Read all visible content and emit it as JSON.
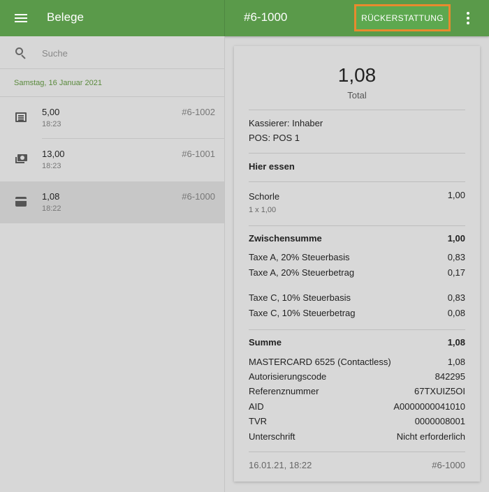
{
  "topbar": {
    "title": "Belege",
    "receipt_id": "#6-1000",
    "refund_label": "RÜCKERSTATTUNG"
  },
  "search": {
    "placeholder": "Suche",
    "value": ""
  },
  "list": {
    "date_header": "Samstag, 16 Januar 2021",
    "items": [
      {
        "amount": "5,00",
        "time": "18:23",
        "id": "#6-1002",
        "icon": "receipt-list-icon",
        "selected": false
      },
      {
        "amount": "13,00",
        "time": "18:23",
        "id": "#6-1001",
        "icon": "cash-icon",
        "selected": false
      },
      {
        "amount": "1,08",
        "time": "18:22",
        "id": "#6-1000",
        "icon": "credit-card-icon",
        "selected": true
      }
    ]
  },
  "receipt": {
    "total": "1,08",
    "total_label": "Total",
    "cashier": "Kassierer: Inhaber",
    "pos": "POS: POS 1",
    "dining": "Hier essen",
    "line_item": {
      "name": "Schorle",
      "price": "1,00",
      "detail": "1 x 1,00"
    },
    "subtotal": {
      "label": "Zwischensumme",
      "value": "1,00"
    },
    "taxes": [
      {
        "label": "Taxe A,  20%  Steuerbasis",
        "value": "0,83"
      },
      {
        "label": "Taxe A,  20%  Steuerbetrag",
        "value": "0,17"
      },
      {
        "label": "Taxe C,  10%  Steuerbasis",
        "value": "0,83"
      },
      {
        "label": "Taxe C,  10%  Steuerbetrag",
        "value": "0,08"
      }
    ],
    "sum": {
      "label": "Summe",
      "value": "1,08"
    },
    "payment": [
      {
        "label": "MASTERCARD 6525 (Contactless)",
        "value": "1,08"
      },
      {
        "label": "Autorisierungscode",
        "value": "842295"
      },
      {
        "label": "Referenznummer",
        "value": "67TXUIZ5OI"
      },
      {
        "label": "AID",
        "value": "A0000000041010"
      },
      {
        "label": "TVR",
        "value": "0000008001"
      },
      {
        "label": "Unterschrift",
        "value": "Nicht erforderlich"
      }
    ],
    "footer": {
      "datetime": "16.01.21, 18:22",
      "id": "#6-1000"
    }
  },
  "colors": {
    "topbar": "#5a9a4a",
    "accent_green": "#5a8a3c",
    "refund_outline": "#e88a2e"
  }
}
